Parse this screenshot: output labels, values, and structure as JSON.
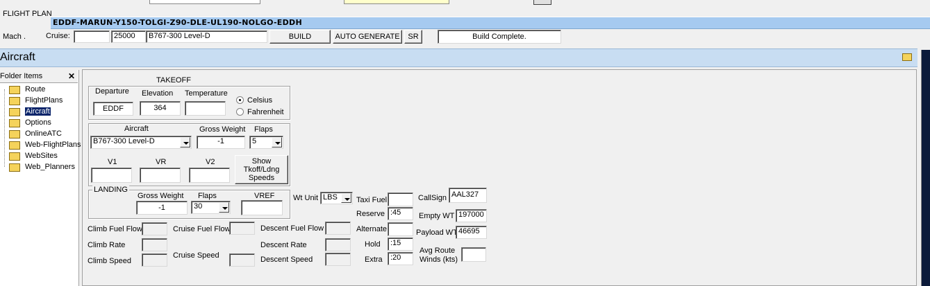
{
  "header": {
    "flight_plan_label": "FLIGHT PLAN",
    "route_string": "EDDF-MARUN-Y150-TOLGI-Z90-DLE-UL190-NOLGO-EDDH",
    "mach_label": "Mach .",
    "cruise_label": "Cruise:",
    "mach_value": "",
    "cruise_value": "25000",
    "aircraft_value": "B767-300 Level-D",
    "build_label": "BUILD",
    "auto_generate_label": "AUTO GENERATE",
    "sr_label": "SR",
    "status_text": "Build Complete."
  },
  "section": {
    "title": "Aircraft"
  },
  "sidebar": {
    "title": "Folder Items",
    "close": "✕",
    "items": [
      {
        "label": "Route"
      },
      {
        "label": "FlightPlans"
      },
      {
        "label": "Aircraft"
      },
      {
        "label": "Options"
      },
      {
        "label": "OnlineATC"
      },
      {
        "label": "Web-FlightPlans"
      },
      {
        "label": "WebSites"
      },
      {
        "label": "Web_Planners"
      }
    ]
  },
  "takeoff": {
    "title": "TAKEOFF",
    "departure_label": "Departure",
    "departure_value": "EDDF",
    "elevation_label": "Elevation",
    "elevation_value": "364",
    "temperature_label": "Temperature",
    "temperature_value": "",
    "celsius_label": "Celsius",
    "fahrenheit_label": "Fahrenheit",
    "aircraft_label": "Aircraft",
    "aircraft_value": "B767-300 Level-D",
    "gross_weight_label": "Gross Weight",
    "gross_weight_value": "-1",
    "flaps_label": "Flaps",
    "flaps_value": "5",
    "v1_label": "V1",
    "vr_label": "VR",
    "v2_label": "V2",
    "v1_value": "",
    "vr_value": "",
    "v2_value": "",
    "show_speeds_label": "Show Tkoff/Ldng Speeds"
  },
  "landing": {
    "title": "LANDING",
    "gross_weight_label": "Gross Weight",
    "gross_weight_value": "-1",
    "flaps_label": "Flaps",
    "flaps_value": "30",
    "vref_label": "VREF",
    "vref_value": ""
  },
  "weights": {
    "wt_unit_label": "Wt Unit",
    "wt_unit_value": "LBS",
    "taxi_fuel_label": "Taxi Fuel",
    "taxi_fuel_value": "",
    "reserve_label": "Reserve",
    "reserve_value": ":45",
    "alternate_label": "Alternate",
    "alternate_value": "",
    "hold_label": "Hold",
    "hold_value": ":15",
    "extra_label": "Extra",
    "extra_value": ":20",
    "callsign_label": "CallSign",
    "callsign_value": "AAL327",
    "empty_wt_label": "Empty WT",
    "empty_wt_value": "197000",
    "payload_wt_label": "Payload WT",
    "payload_wt_value": "46695",
    "avg_winds_label": "Avg Route Winds (kts)",
    "avg_winds_value": ""
  },
  "performance": {
    "climb_fuel_flow_label": "Climb Fuel Flow",
    "climb_rate_label": "Climb Rate",
    "climb_speed_label": "Climb Speed",
    "cruise_fuel_flow_label": "Cruise Fuel Flow",
    "cruise_speed_label": "Cruise Speed",
    "descent_fuel_flow_label": "Descent Fuel Flow",
    "descent_rate_label": "Descent Rate",
    "descent_speed_label": "Descent Speed"
  },
  "colors": {
    "route_bar": "#a6caf0",
    "section_bar": "#c8ddf2",
    "selection": "#0a246a",
    "folder": "#f5d35b"
  }
}
